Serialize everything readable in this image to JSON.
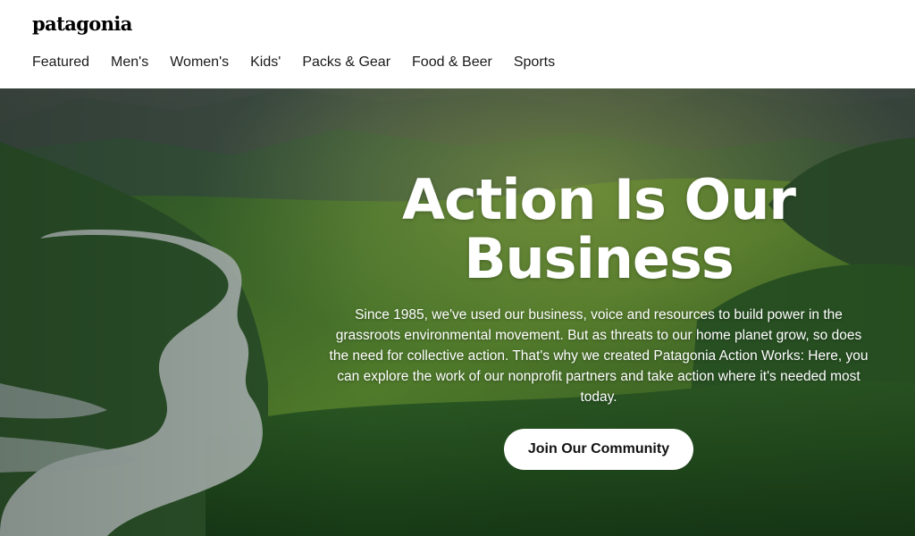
{
  "header": {
    "logo_text": "patagonia",
    "nav": [
      "Featured",
      "Men's",
      "Women's",
      "Kids'",
      "Packs & Gear",
      "Food & Beer",
      "Sports"
    ]
  },
  "hero": {
    "title": "Action Is Our Business",
    "body": "Since 1985, we've used our business, voice and resources to build power in the grassroots environmental movement. But as threats to our home planet grow, so does the need for collective action. That's why we created Patagonia Action Works: Here, you can explore the work of our nonprofit partners and take action where it's needed most today.",
    "cta_label": "Join Our Community",
    "background_image": "green-mountain-valley-with-river-photo"
  },
  "colors": {
    "header_bg": "#ffffff",
    "hero_text": "#ffffff",
    "cta_bg": "#ffffff",
    "cta_text": "#111111"
  }
}
